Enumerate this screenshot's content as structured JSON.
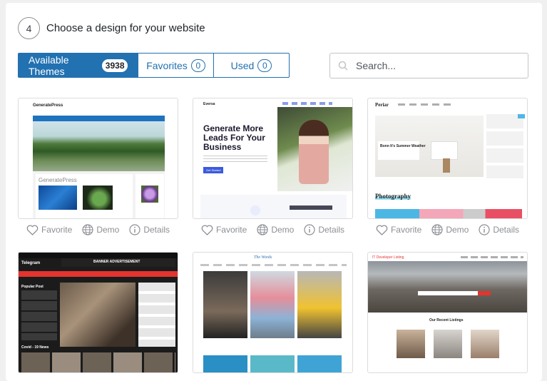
{
  "step": {
    "number": "4",
    "title": "Choose a design for your website"
  },
  "tabs": [
    {
      "label": "Available Themes",
      "count": "3938"
    },
    {
      "label": "Favorites",
      "count": "0"
    },
    {
      "label": "Used",
      "count": "0"
    }
  ],
  "search": {
    "placeholder": "Search..."
  },
  "card_actions": {
    "favorite": "Favorite",
    "demo": "Demo",
    "details": "Details"
  },
  "themes": [
    {
      "title": "GeneratePress",
      "body_title": "GeneratePress"
    },
    {
      "title": "Eversa",
      "headline": "Generate More Leads For Your Business",
      "cta": "Get Started"
    },
    {
      "title": "Periar",
      "post_title": "Bonn It's Summer Weather",
      "section": "Photography"
    },
    {
      "title": "Telegram",
      "banner": "BANNER ADVERTISEMENT",
      "popular": "Popular Post",
      "section": "Covid - 19 News"
    },
    {
      "title": "The Words"
    },
    {
      "title": "IT Developer Listing",
      "section": "Our Recent Listings"
    }
  ],
  "colors": {
    "accent": "#2271b1"
  }
}
